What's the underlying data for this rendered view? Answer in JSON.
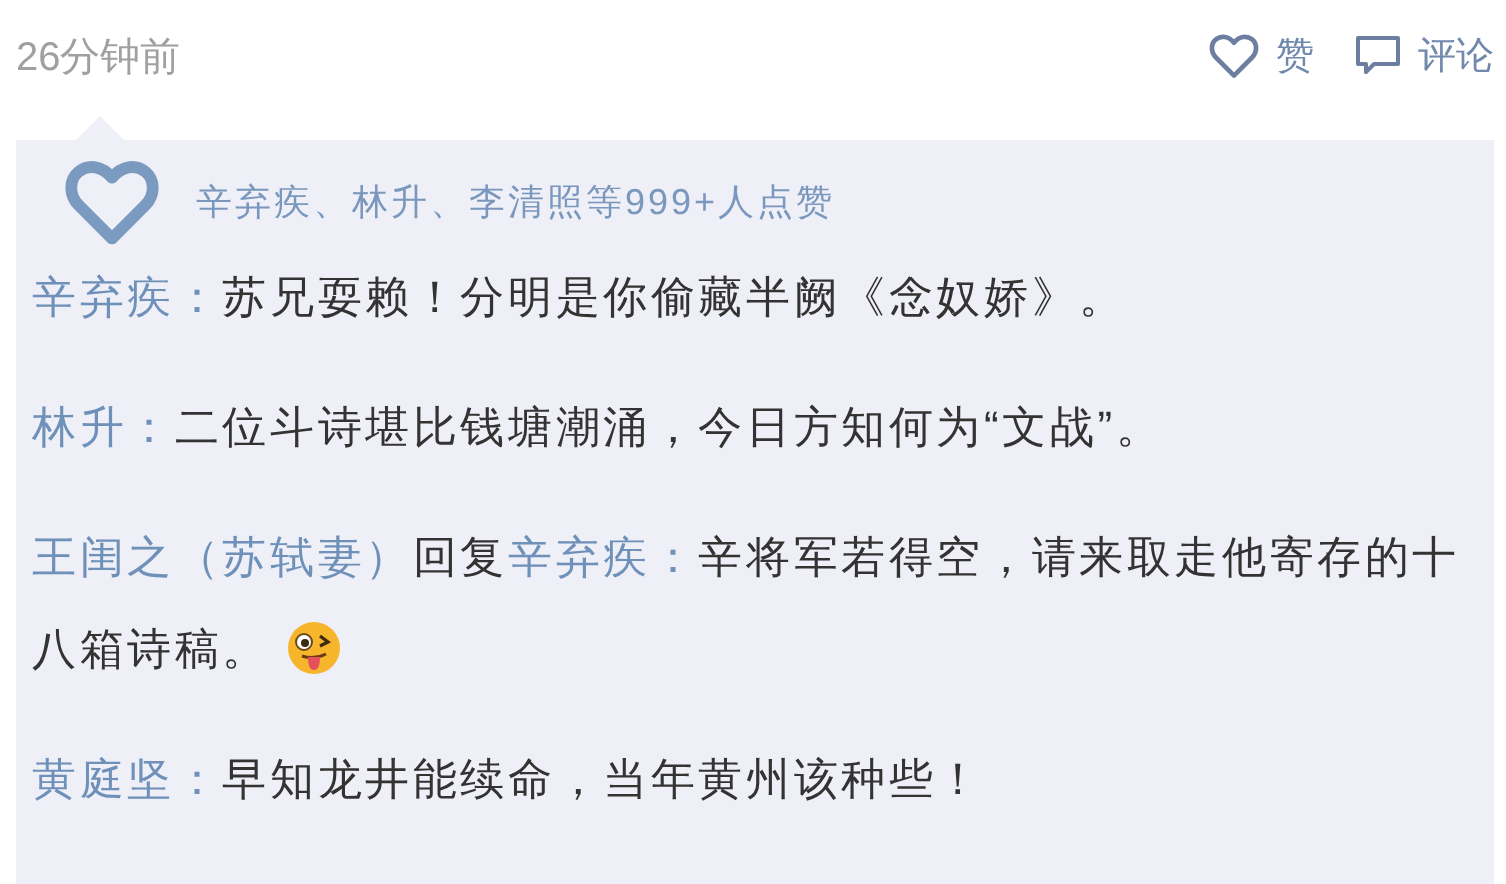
{
  "post": {
    "time": "26分钟前",
    "like_label": "赞",
    "comment_label": "评论"
  },
  "likes": {
    "text": "辛弃疾、林升、李清照等999+人点赞"
  },
  "comments": [
    {
      "author": "辛弃疾：",
      "text": "苏兄耍赖！分明是你偷藏半阙《念奴娇》。"
    },
    {
      "author": "林升：",
      "text": "二位斗诗堪比钱塘潮涌，今日方知何为“文战”。"
    },
    {
      "author": "王闺之（苏轼妻）",
      "reply_word": "回复",
      "reply_to": "辛弃疾：",
      "text": "辛将军若得空，请来取走他寄存的十八箱诗稿。",
      "has_emoji": true
    },
    {
      "author": "黄庭坚：",
      "text": "早知龙井能续命，当年黄州该种些！"
    }
  ]
}
